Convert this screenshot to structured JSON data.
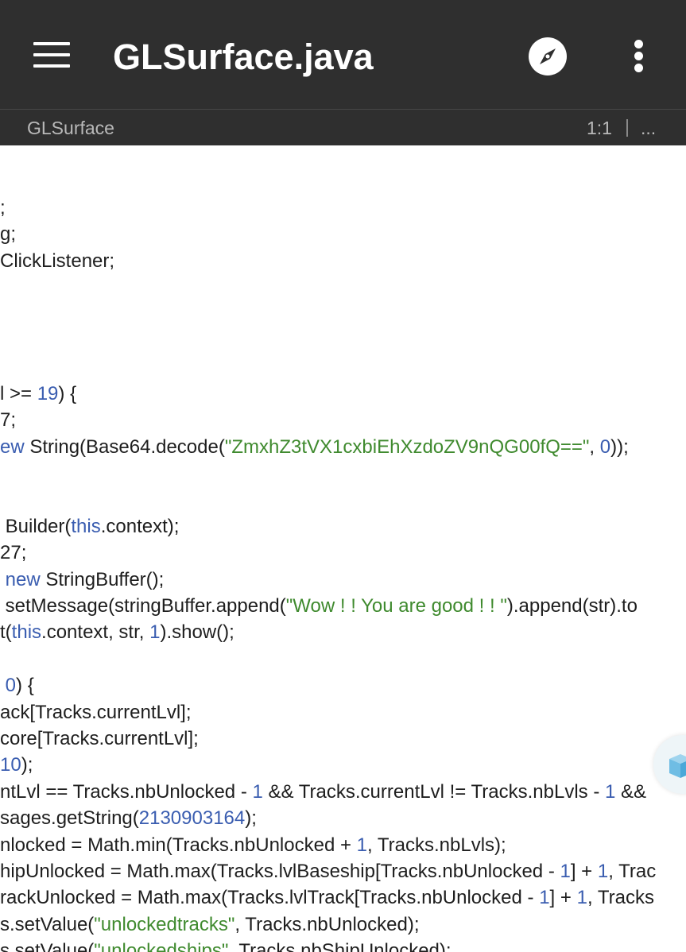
{
  "appbar": {
    "title": "GLSurface.java",
    "icons": {
      "menu": "menu-icon",
      "navigate": "compass-icon",
      "overflow": "more-vert-icon"
    }
  },
  "pathbar": {
    "breadcrumb": "GLSurface",
    "cursor_position": "1:1",
    "more": "..."
  },
  "colors": {
    "toolbar": "#2f2f2f",
    "keyword": "#3a5db0",
    "number": "#3a5db0",
    "string": "#3f8a2e",
    "text": "#1e1e1e"
  },
  "code_lines": [
    [
      {
        "t": ";"
      }
    ],
    [
      {
        "t": "g;"
      }
    ],
    [
      {
        "t": "ClickListener;"
      }
    ],
    [
      {
        "t": ""
      }
    ],
    [
      {
        "t": ""
      }
    ],
    [
      {
        "t": ""
      }
    ],
    [
      {
        "t": ""
      }
    ],
    [
      {
        "t": "l >= "
      },
      {
        "t": "19",
        "c": "num"
      },
      {
        "t": ") {"
      }
    ],
    [
      {
        "t": "7;"
      }
    ],
    [
      {
        "t": "ew",
        "c": "kw"
      },
      {
        "t": " String(Base64.decode("
      },
      {
        "t": "\"ZmxhZ3tVX1cxbiEhXzdoZV9nQG00fQ==\"",
        "c": "str"
      },
      {
        "t": ", "
      },
      {
        "t": "0",
        "c": "num"
      },
      {
        "t": "));"
      }
    ],
    [
      {
        "t": ""
      }
    ],
    [
      {
        "t": ""
      }
    ],
    [
      {
        "t": " Builder("
      },
      {
        "t": "this",
        "c": "kw"
      },
      {
        "t": ".context);"
      }
    ],
    [
      {
        "t": "27;"
      }
    ],
    [
      {
        "t": " "
      },
      {
        "t": "new",
        "c": "kw"
      },
      {
        "t": " StringBuffer();"
      }
    ],
    [
      {
        "t": " setMessage(stringBuffer.append("
      },
      {
        "t": "\"Wow ! ! You are good ! ! \"",
        "c": "str"
      },
      {
        "t": ").append(str).to"
      }
    ],
    [
      {
        "t": "t("
      },
      {
        "t": "this",
        "c": "kw"
      },
      {
        "t": ".context, str, "
      },
      {
        "t": "1",
        "c": "num"
      },
      {
        "t": ").show();"
      }
    ],
    [
      {
        "t": ""
      }
    ],
    [
      {
        "t": " "
      },
      {
        "t": "0",
        "c": "num"
      },
      {
        "t": ") {"
      }
    ],
    [
      {
        "t": "ack[Tracks.currentLvl];"
      }
    ],
    [
      {
        "t": "core[Tracks.currentLvl];"
      }
    ],
    [
      {
        "t": "10",
        "c": "num"
      },
      {
        "t": ");"
      }
    ],
    [
      {
        "t": "ntLvl == Tracks.nbUnlocked - "
      },
      {
        "t": "1",
        "c": "num"
      },
      {
        "t": " && Tracks.currentLvl != Tracks.nbLvls - "
      },
      {
        "t": "1",
        "c": "num"
      },
      {
        "t": " &&"
      }
    ],
    [
      {
        "t": "sages.getString("
      },
      {
        "t": "2130903164",
        "c": "num"
      },
      {
        "t": ");"
      }
    ],
    [
      {
        "t": "nlocked = Math.min(Tracks.nbUnlocked + "
      },
      {
        "t": "1",
        "c": "num"
      },
      {
        "t": ", Tracks.nbLvls);"
      }
    ],
    [
      {
        "t": "hipUnlocked = Math.max(Tracks.lvlBaseship[Tracks.nbUnlocked - "
      },
      {
        "t": "1",
        "c": "num"
      },
      {
        "t": "] + "
      },
      {
        "t": "1",
        "c": "num"
      },
      {
        "t": ", Trac"
      }
    ],
    [
      {
        "t": "rackUnlocked = Math.max(Tracks.lvlTrack[Tracks.nbUnlocked - "
      },
      {
        "t": "1",
        "c": "num"
      },
      {
        "t": "] + "
      },
      {
        "t": "1",
        "c": "num"
      },
      {
        "t": ", Tracks"
      }
    ],
    [
      {
        "t": "s.setValue("
      },
      {
        "t": "\"unlockedtracks\"",
        "c": "str"
      },
      {
        "t": ", Tracks.nbUnlocked);"
      }
    ],
    [
      {
        "t": "s.setValue("
      },
      {
        "t": "\"unlockedships\"",
        "c": "str"
      },
      {
        "t": ", Tracks.nbShipUnlocked);"
      }
    ]
  ],
  "floating_button": {
    "icon": "cube-icon"
  }
}
